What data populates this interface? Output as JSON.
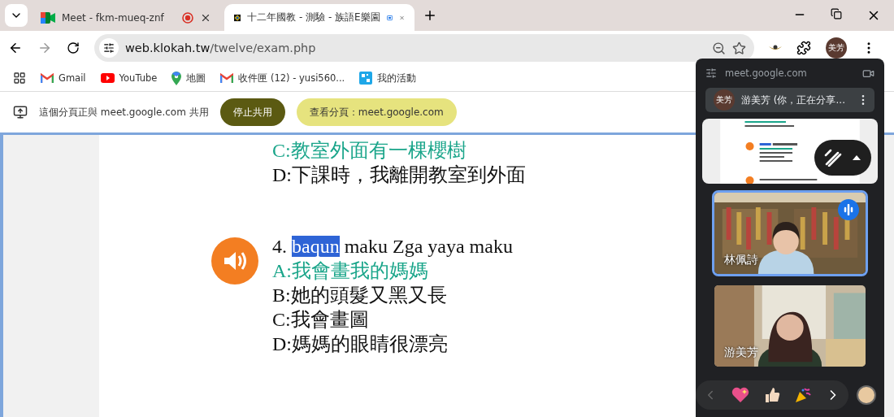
{
  "tabs": [
    {
      "title": "Meet - fkm-mueq-znf",
      "selected": false,
      "kind": "meet"
    },
    {
      "title": "十二年國教 - 測驗 - 族語E樂園",
      "selected": true,
      "kind": "site"
    }
  ],
  "address": {
    "host": "web.klokah.tw",
    "path": "/twelve/exam.php"
  },
  "profile": {
    "initials": "美芳"
  },
  "bookmarks": [
    {
      "label": "Gmail",
      "kind": "gmail"
    },
    {
      "label": "YouTube",
      "kind": "youtube"
    },
    {
      "label": "地圖",
      "kind": "maps"
    },
    {
      "label": "收件匣 (12) - yusi560...",
      "kind": "gmail"
    },
    {
      "label": "我的活動",
      "kind": "activity"
    }
  ],
  "share_bar": {
    "message": "這個分頁正與 meet.google.com 共用",
    "stop_button": "停止共用",
    "view_button": "查看分頁：meet.google.com"
  },
  "exam": {
    "prev_options": [
      {
        "text": "C:教室外面有一棵櫻樹",
        "correct": true
      },
      {
        "text": "D:下課時，我離開教室到外面",
        "correct": false
      }
    ],
    "question": {
      "number": "4.",
      "highlight": "baqun",
      "rest": "maku Zga yaya maku"
    },
    "options": [
      {
        "text": "A:我會畫我的媽媽",
        "correct": true
      },
      {
        "text": "B:她的頭髮又黑又長",
        "correct": false
      },
      {
        "text": "C:我會畫圖",
        "correct": false
      },
      {
        "text": "D:媽媽的眼睛很漂亮",
        "correct": false
      }
    ]
  },
  "meet": {
    "site": "meet.google.com",
    "presenter": {
      "initials": "美芳",
      "label": "游美芳 (你，正在分享..."
    },
    "participants": [
      {
        "name": "林佩詩",
        "selected": true,
        "speaking": true,
        "kind": "trophies"
      },
      {
        "name": "游美芳",
        "selected": false,
        "speaking": false,
        "kind": "room"
      }
    ]
  }
}
